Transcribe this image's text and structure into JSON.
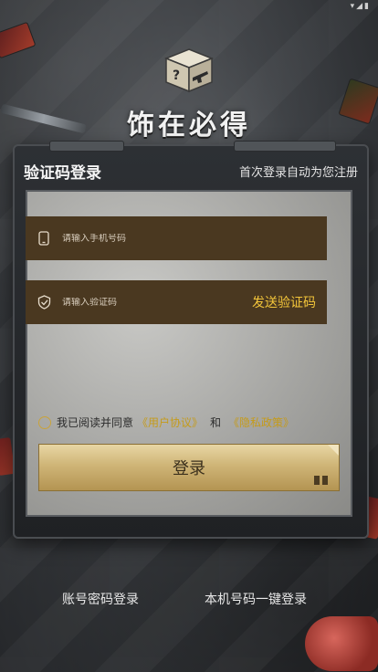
{
  "app": {
    "title": "饰在必得"
  },
  "form": {
    "heading": "验证码登录",
    "hint": "首次登录自动为您注册",
    "phone_placeholder": "请输入手机号码",
    "code_placeholder": "请输入验证码",
    "send_code_label": "发送验证码",
    "agreement_prefix": "我已阅读并同意",
    "user_agreement": "《用户协议》",
    "and": "和",
    "privacy_policy": "《隐私政策》",
    "login_label": "登录"
  },
  "footer": {
    "password_login": "账号密码登录",
    "one_click_login": "本机号码一键登录"
  },
  "icons": {
    "logo": "mystery-box-icon",
    "phone": "phone-icon",
    "shield": "shield-check-icon"
  },
  "colors": {
    "accent_gold": "#f4c63a",
    "field_brown": "#4a3820",
    "button_gold": "#cfb577"
  }
}
